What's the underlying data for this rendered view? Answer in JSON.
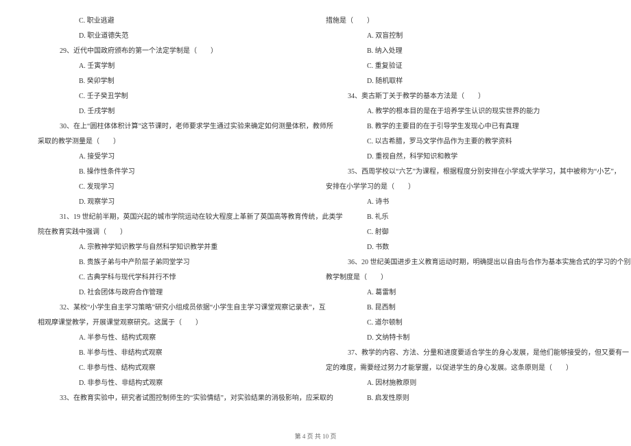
{
  "left": [
    {
      "cls": "indent-2",
      "text": "C. 职业逃避"
    },
    {
      "cls": "indent-2",
      "text": "D. 职业道德失范"
    },
    {
      "cls": "indent-1",
      "text": "29、近代中国政府颁布的第一个法定学制是（　　）"
    },
    {
      "cls": "indent-2",
      "text": "A. 壬寅学制"
    },
    {
      "cls": "indent-2",
      "text": "B. 癸卯学制"
    },
    {
      "cls": "indent-2",
      "text": "C. 壬子癸丑学制"
    },
    {
      "cls": "indent-2",
      "text": "D. 壬戌学制"
    },
    {
      "cls": "indent-1",
      "text": "30、在上“圆柱体体积计算”这节课时，老师要求学生通过实验来确定如何测量体积，教师所"
    },
    {
      "cls": "indent-0",
      "text": "采取的教学测量是（　　）"
    },
    {
      "cls": "indent-2",
      "text": "A. 接受学习"
    },
    {
      "cls": "indent-2",
      "text": "B. 操作性条件学习"
    },
    {
      "cls": "indent-2",
      "text": "C. 发现学习"
    },
    {
      "cls": "indent-2",
      "text": "D. 观察学习"
    },
    {
      "cls": "indent-1",
      "text": "31、19 世纪前半期，英国兴起的城市学院运动在较大程度上革新了英国高等教育传统，此类学"
    },
    {
      "cls": "indent-0",
      "text": "院在教育实践中强调（　　）"
    },
    {
      "cls": "indent-2",
      "text": "A. 宗教神学知识教学与自然科学知识教学并重"
    },
    {
      "cls": "indent-2",
      "text": "B. 贵族子弟与中产阶层子弟同堂学习"
    },
    {
      "cls": "indent-2",
      "text": "C. 古典学科与现代学科并行不悖"
    },
    {
      "cls": "indent-2",
      "text": "D. 社会团体与政府合作管理"
    },
    {
      "cls": "indent-1",
      "text": "32、某校“小学生自主学习策略”研究小组成员依据“小学生自主学习课堂观察记录表”，互"
    },
    {
      "cls": "indent-0",
      "text": "相观摩课堂教学，开展课堂观察研究。这属于（　　）"
    },
    {
      "cls": "indent-2",
      "text": "A. 半参与性、结构式观察"
    },
    {
      "cls": "indent-2",
      "text": "B. 半参与性、非结构式观察"
    },
    {
      "cls": "indent-2",
      "text": "C. 非参与性、结构式观察"
    },
    {
      "cls": "indent-2",
      "text": "D. 非参与性、非结构式观察"
    },
    {
      "cls": "indent-1",
      "text": "33、在教育实验中，研究者试图控制师生的“实验情结”，对实验结果的消极影响，应采取的"
    }
  ],
  "right": [
    {
      "cls": "indent-0",
      "text": "措施是（　　）"
    },
    {
      "cls": "indent-2",
      "text": "A. 双盲控制"
    },
    {
      "cls": "indent-2",
      "text": "B. 纳入处理"
    },
    {
      "cls": "indent-2",
      "text": "C. 重复验证"
    },
    {
      "cls": "indent-2",
      "text": "D. 随机取样"
    },
    {
      "cls": "indent-1",
      "text": "34、奥古斯丁关于教学的基本方法是（　　）"
    },
    {
      "cls": "indent-2",
      "text": "A. 教学的根本目的是在于培养学生认识的现实世界的能力"
    },
    {
      "cls": "indent-2",
      "text": "B. 教学的主要目的在于引导学生发现心中已有真理"
    },
    {
      "cls": "indent-2",
      "text": "C. 以古希腊，罗马文学作品作为主要的教学资料"
    },
    {
      "cls": "indent-2",
      "text": "D. 重视自然，科学知识和教学"
    },
    {
      "cls": "indent-1",
      "text": "35、西周学校以“六艺”为课程，根据程度分别安排在小学或大学学习，其中被称为“小艺”，"
    },
    {
      "cls": "indent-0",
      "text": "安排在小学学习的是（　　）"
    },
    {
      "cls": "indent-2",
      "text": "A. 诗书"
    },
    {
      "cls": "indent-2",
      "text": "B. 礼乐"
    },
    {
      "cls": "indent-2",
      "text": "C. 射御"
    },
    {
      "cls": "indent-2",
      "text": "D. 书数"
    },
    {
      "cls": "indent-1",
      "text": "36、20 世纪美国进步主义教育运动时期，明确提出以自由与合作为基本实施合式的学习的个别"
    },
    {
      "cls": "indent-0",
      "text": "教学制度是（　　）"
    },
    {
      "cls": "indent-2",
      "text": "A. 葛雷制"
    },
    {
      "cls": "indent-2",
      "text": "B. 昆西制"
    },
    {
      "cls": "indent-2",
      "text": "C. 道尔顿制"
    },
    {
      "cls": "indent-2",
      "text": "D. 文纳特卡制"
    },
    {
      "cls": "indent-1",
      "text": "37、教学的内容、方法、分量和进度要适合学生的身心发展，是他们能够接受的，但又要有一"
    },
    {
      "cls": "indent-0",
      "text": "定的难度，需要经过努力才能掌握，以促进学生的身心发展。这条原则是（　　）"
    },
    {
      "cls": "indent-2",
      "text": "A. 因材施教原则"
    },
    {
      "cls": "indent-2",
      "text": "B. 启发性原则"
    }
  ],
  "footer": "第 4 页 共 10 页"
}
